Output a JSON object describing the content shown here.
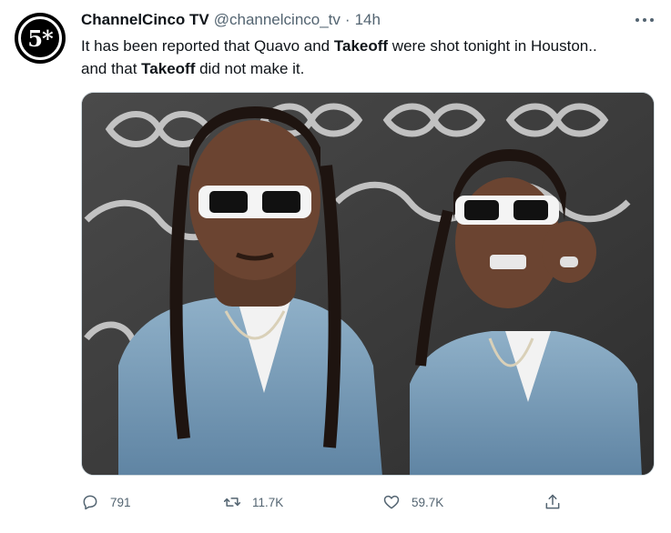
{
  "tweet": {
    "avatar_text": "5*",
    "display_name": "ChannelCinco TV",
    "handle": "@channelcinco_tv",
    "separator": "·",
    "timestamp": "14h",
    "text_part1": "It has been reported that Quavo and ",
    "text_bold1": "Takeoff",
    "text_part2": " were shot tonight in Houston..",
    "text_part3": "and that ",
    "text_bold2": "Takeoff",
    "text_part4": " did not make it.",
    "media_icon": "photo"
  },
  "actions": {
    "reply_icon": "reply-icon",
    "reply_count": "791",
    "retweet_icon": "retweet-icon",
    "retweet_count": "11.7K",
    "like_icon": "heart-icon",
    "like_count": "59.7K",
    "share_icon": "share-icon"
  },
  "colors": {
    "text_primary": "#0f1419",
    "text_secondary": "#536471",
    "border": "#cfd9de"
  }
}
